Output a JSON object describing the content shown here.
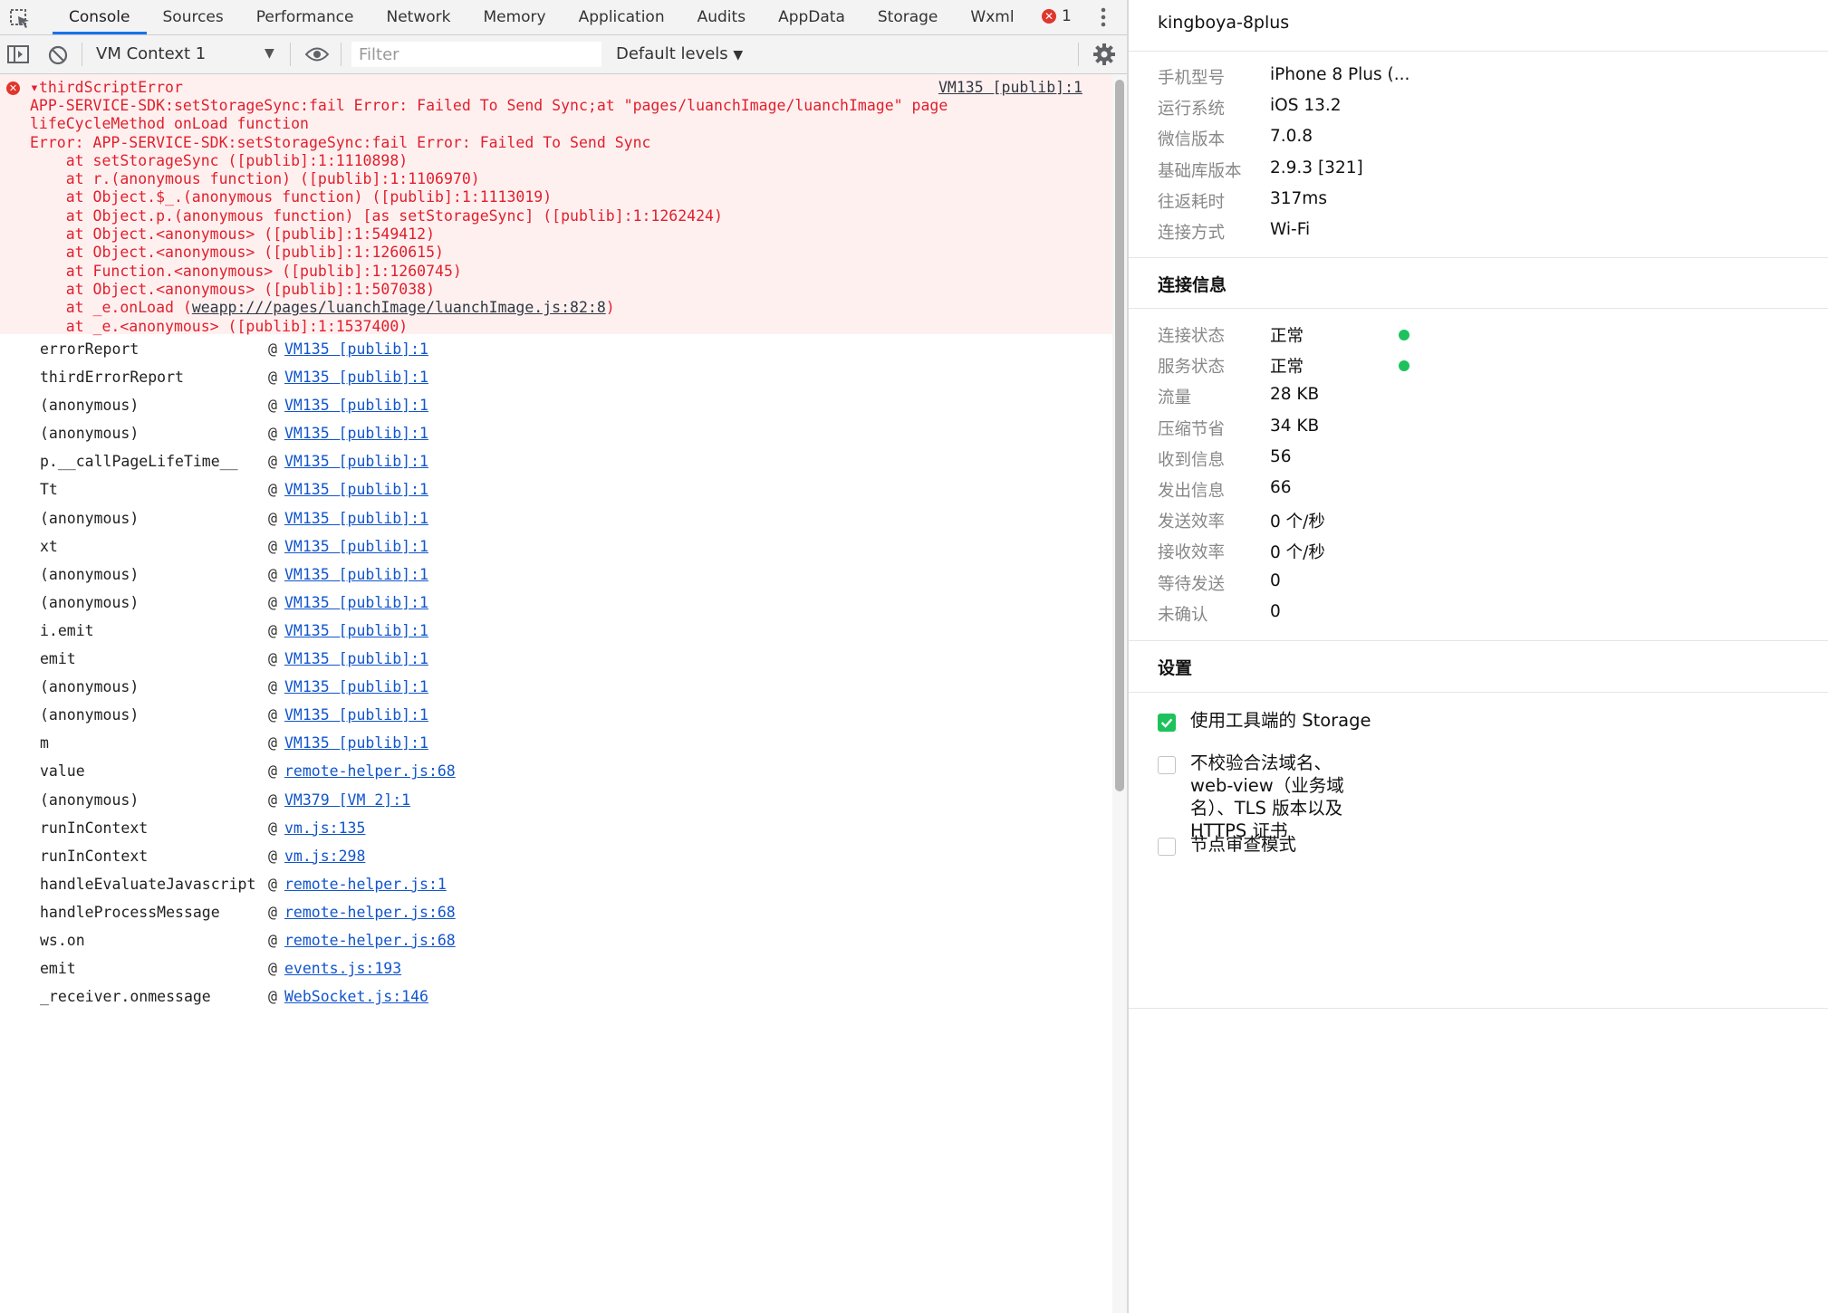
{
  "tabs": [
    "Console",
    "Sources",
    "Performance",
    "Network",
    "Memory",
    "Application",
    "Audits",
    "AppData",
    "Storage",
    "Wxml"
  ],
  "error_count": "1",
  "toolbar": {
    "context": "VM Context 1",
    "filter_placeholder": "Filter",
    "levels": "Default levels"
  },
  "console": {
    "error": {
      "head": "thirdScriptError",
      "source": "VM135 [publib]:1",
      "body_lines": [
        "APP-SERVICE-SDK:setStorageSync:fail Error: Failed To Send Sync;at \"pages/luanchImage/luanchImage\" page",
        "lifeCycleMethod onLoad function",
        "Error: APP-SERVICE-SDK:setStorageSync:fail Error: Failed To Send Sync",
        "    at setStorageSync ([publib]:1:1110898)",
        "    at r.(anonymous function) ([publib]:1:1106970)",
        "    at Object.$_.(anonymous function) ([publib]:1:1113019)",
        "    at Object.p.(anonymous function) [as setStorageSync] ([publib]:1:1262424)",
        "    at Object.<anonymous> ([publib]:1:549412)",
        "    at Object.<anonymous> ([publib]:1:1260615)",
        "    at Function.<anonymous> ([publib]:1:1260745)",
        "    at Object.<anonymous> ([publib]:1:507038)",
        "    at _e.onLoad (",
        "    at _e.<anonymous> ([publib]:1:1537400)"
      ],
      "onload_link": "weapp:///pages/luanchImage/luanchImage.js:82:8"
    },
    "stack": [
      {
        "fn": "errorReport",
        "loc": "VM135 [publib]:1"
      },
      {
        "fn": "thirdErrorReport",
        "loc": "VM135 [publib]:1"
      },
      {
        "fn": "(anonymous)",
        "loc": "VM135 [publib]:1"
      },
      {
        "fn": "(anonymous)",
        "loc": "VM135 [publib]:1"
      },
      {
        "fn": "p.__callPageLifeTime__",
        "loc": "VM135 [publib]:1"
      },
      {
        "fn": "Tt",
        "loc": "VM135 [publib]:1"
      },
      {
        "fn": "(anonymous)",
        "loc": "VM135 [publib]:1"
      },
      {
        "fn": "xt",
        "loc": "VM135 [publib]:1"
      },
      {
        "fn": "(anonymous)",
        "loc": "VM135 [publib]:1"
      },
      {
        "fn": "(anonymous)",
        "loc": "VM135 [publib]:1"
      },
      {
        "fn": "i.emit",
        "loc": "VM135 [publib]:1"
      },
      {
        "fn": "emit",
        "loc": "VM135 [publib]:1"
      },
      {
        "fn": "(anonymous)",
        "loc": "VM135 [publib]:1"
      },
      {
        "fn": "(anonymous)",
        "loc": "VM135 [publib]:1"
      },
      {
        "fn": "m",
        "loc": "VM135 [publib]:1"
      },
      {
        "fn": "value",
        "loc": "remote-helper.js:68"
      },
      {
        "fn": "(anonymous)",
        "loc": "VM379 [VM 2]:1"
      },
      {
        "fn": "runInContext",
        "loc": "vm.js:135"
      },
      {
        "fn": "runInContext",
        "loc": "vm.js:298"
      },
      {
        "fn": "handleEvaluateJavascript",
        "loc": "remote-helper.js:1"
      },
      {
        "fn": "handleProcessMessage",
        "loc": "remote-helper.js:68"
      },
      {
        "fn": "ws.on",
        "loc": "remote-helper.js:68"
      },
      {
        "fn": "emit",
        "loc": "events.js:193"
      },
      {
        "fn": "_receiver.onmessage",
        "loc": "WebSocket.js:146"
      }
    ],
    "at_sign": "@"
  },
  "side": {
    "title": "kingboya-8plus",
    "device": [
      {
        "k": "手机型号",
        "v": "iPhone 8 Plus (..."
      },
      {
        "k": "运行系统",
        "v": "iOS 13.2"
      },
      {
        "k": "微信版本",
        "v": "7.0.8"
      },
      {
        "k": "基础库版本",
        "v": "2.9.3 [321]"
      },
      {
        "k": "往返耗时",
        "v": "317ms"
      },
      {
        "k": "连接方式",
        "v": "Wi-Fi"
      }
    ],
    "conn_title": "连接信息",
    "conn": [
      {
        "k": "连接状态",
        "v": "正常"
      },
      {
        "k": "服务状态",
        "v": "正常"
      },
      {
        "k": "流量",
        "v": "28 KB"
      },
      {
        "k": "压缩节省",
        "v": "34 KB"
      },
      {
        "k": "收到信息",
        "v": "56"
      },
      {
        "k": "发出信息",
        "v": "66"
      },
      {
        "k": "发送效率",
        "v": "0 个/秒"
      },
      {
        "k": "接收效率",
        "v": "0 个/秒"
      },
      {
        "k": "等待发送",
        "v": "0"
      },
      {
        "k": "未确认",
        "v": "0"
      }
    ],
    "settings_title": "设置",
    "settings": [
      {
        "label": "使用工具端的 Storage",
        "checked": true
      },
      {
        "label": "不校验合法域名、web-view（业务域名）、TLS 版本以及 HTTPS 证书",
        "checked": false
      },
      {
        "label": "节点审查模式",
        "checked": false
      }
    ],
    "status_color": "#1dc25c"
  },
  "colors": {
    "error_text": "#e0202c",
    "error_bg": "#fff0f0",
    "link": "#1155cc",
    "accent": "#1a73e8"
  }
}
